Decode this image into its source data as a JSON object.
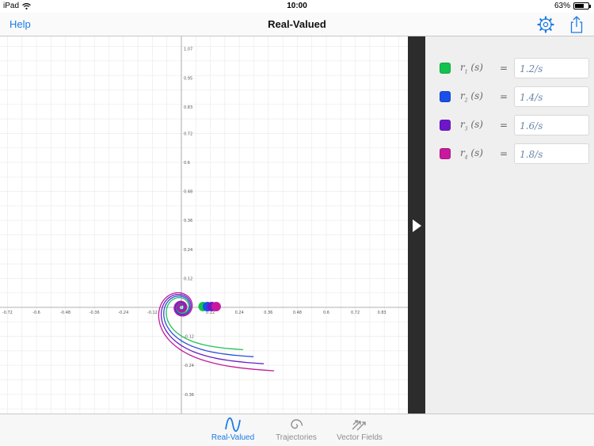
{
  "status": {
    "device": "iPad",
    "time": "10:00",
    "battery": "63%",
    "battery_level": 0.63
  },
  "nav": {
    "help_label": "Help",
    "title": "Real-Valued",
    "settings_icon": "gear-icon",
    "share_icon": "share-icon"
  },
  "graph": {
    "x_ticks": [
      "-0.72",
      "-0.6",
      "-0.48",
      "-0.36",
      "-0.24",
      "-0.12",
      "0",
      "0.12",
      "0.24",
      "0.36",
      "0.48",
      "0.6",
      "0.72",
      "0.83"
    ],
    "y_ticks": [
      "1.07",
      "0.95",
      "0.83",
      "0.72",
      "0.6",
      "0.48",
      "0.36",
      "0.24",
      "0.12",
      "-0.12",
      "-0.24",
      "-0.36"
    ],
    "curve_colors": [
      "#21c15a",
      "#2b50d6",
      "#6a1fc4",
      "#c21a9a"
    ]
  },
  "functions": [
    {
      "label": "r",
      "index": "1",
      "arg": "(s)",
      "eq": "=",
      "value": "1.2/s",
      "color": "#13c24e"
    },
    {
      "label": "r",
      "index": "2",
      "arg": "(s)",
      "eq": "=",
      "value": "1.4/s",
      "color": "#1a4fe8"
    },
    {
      "label": "r",
      "index": "3",
      "arg": "(s)",
      "eq": "=",
      "value": "1.6/s",
      "color": "#6e17c8"
    },
    {
      "label": "r",
      "index": "4",
      "arg": "(s)",
      "eq": "=",
      "value": "1.8/s",
      "color": "#c8189e"
    }
  ],
  "tabs": [
    {
      "label": "Real-Valued",
      "icon": "wave-icon",
      "active": true
    },
    {
      "label": "Trajectories",
      "icon": "spiral-icon",
      "active": false
    },
    {
      "label": "Vector Fields",
      "icon": "vector-arrows-icon",
      "active": false
    }
  ]
}
